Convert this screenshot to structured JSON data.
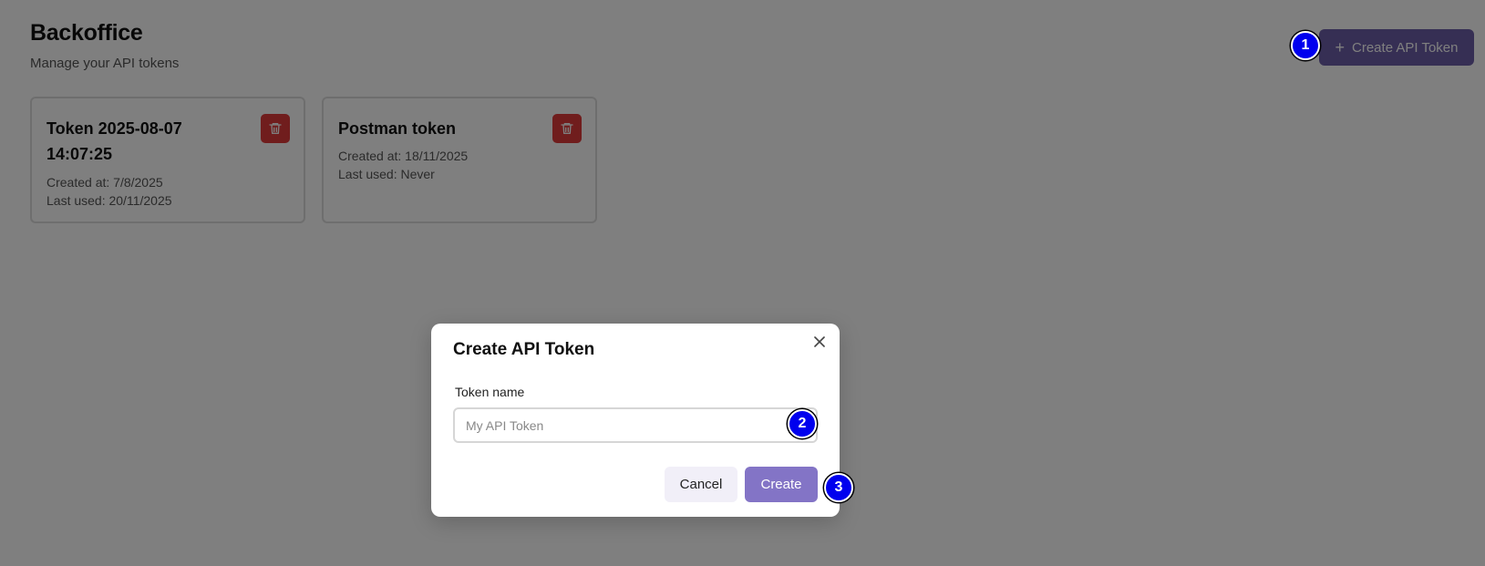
{
  "header": {
    "title": "Backoffice",
    "subtitle": "Manage your API tokens",
    "create_button_label": "Create API Token"
  },
  "tokens": [
    {
      "name": "Token 2025-08-07 14:07:25",
      "created": "Created at: 7/8/2025",
      "last_used": "Last used: 20/11/2025"
    },
    {
      "name": "Postman token",
      "created": "Created at: 18/11/2025",
      "last_used": "Last used: Never"
    }
  ],
  "modal": {
    "title": "Create API Token",
    "field_label": "Token name",
    "field_placeholder": "My API Token",
    "field_value": "",
    "cancel_label": "Cancel",
    "submit_label": "Create"
  },
  "markers": [
    "1",
    "2",
    "3"
  ],
  "colors": {
    "primary": "#8374c6",
    "primary_dark": "#6d5fa8",
    "danger": "#e03a3a",
    "marker": "#0000ee"
  },
  "icons": {
    "create_button": "plus-icon",
    "card_delete": "trash-icon",
    "modal_close": "close-icon"
  }
}
